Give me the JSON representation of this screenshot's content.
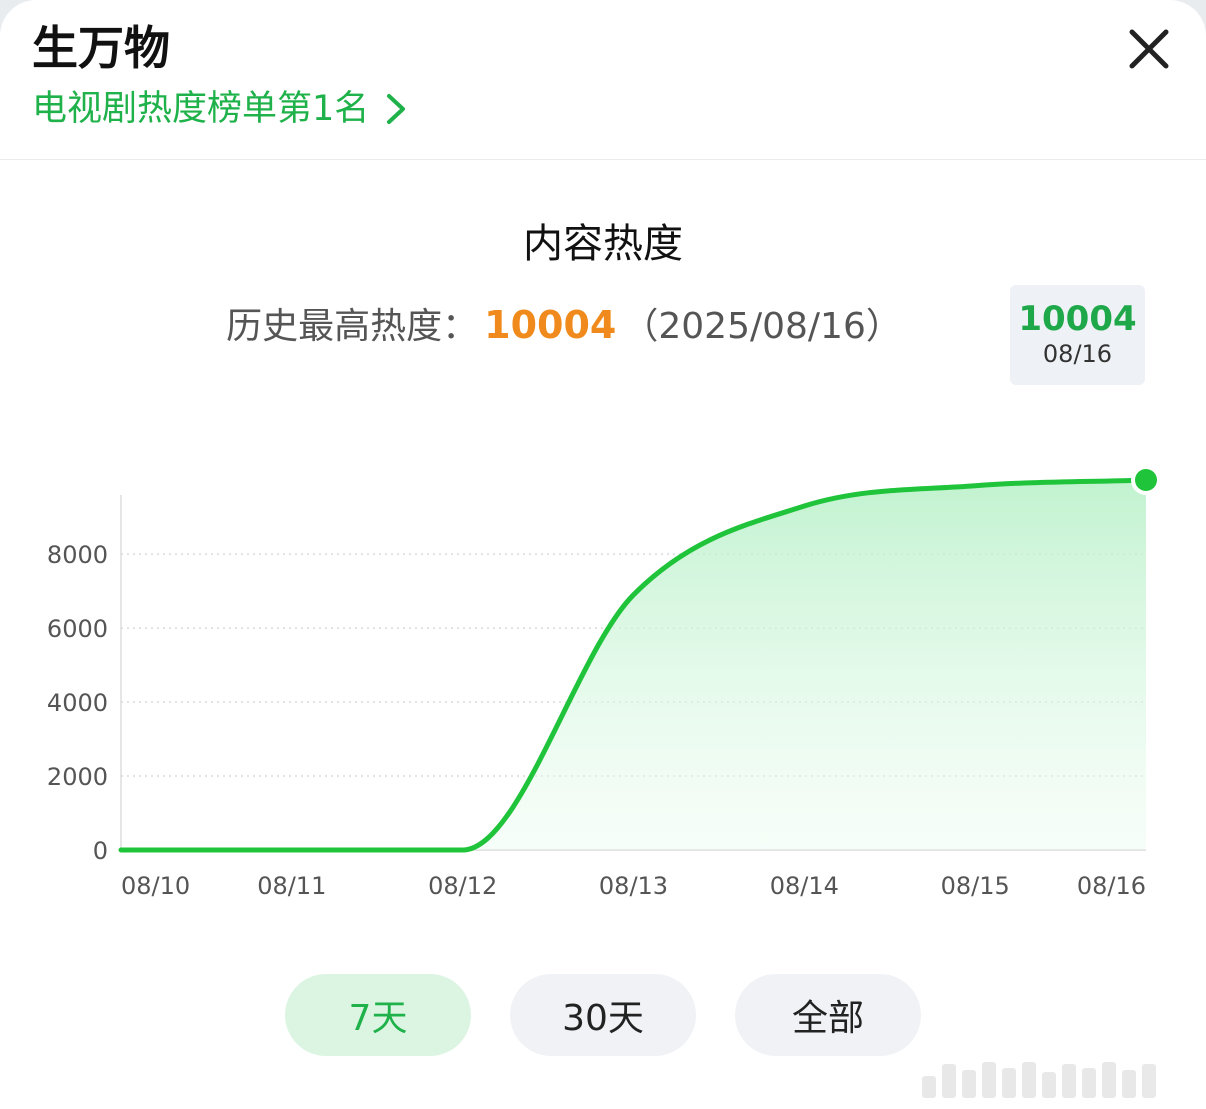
{
  "header": {
    "title": "生万物",
    "rank_link": "电视剧热度榜单第1名"
  },
  "content": {
    "section_title": "内容热度",
    "history_label": "历史最高热度：",
    "history_value": "10004",
    "history_date": "（2025/08/16）"
  },
  "tooltip": {
    "value": "10004",
    "date": "08/16"
  },
  "tabs": [
    {
      "label": "7天",
      "active": true
    },
    {
      "label": "30天",
      "active": false
    },
    {
      "label": "全部",
      "active": false
    }
  ],
  "colors": {
    "accent": "#1fb14a",
    "line": "#1fc43a",
    "highlight": "#f18a1c"
  },
  "chart_data": {
    "type": "area",
    "x": [
      "08/10",
      "08/11",
      "08/12",
      "08/13",
      "08/14",
      "08/15",
      "08/16"
    ],
    "series": [
      {
        "values": [
          0,
          0,
          0,
          6900,
          9300,
          9850,
          10004
        ]
      }
    ],
    "yticks": [
      0,
      2000,
      4000,
      6000,
      8000
    ],
    "ylim": [
      0,
      10004
    ],
    "grid": true,
    "highlight_point": {
      "x": "08/16",
      "y": 10004
    }
  }
}
